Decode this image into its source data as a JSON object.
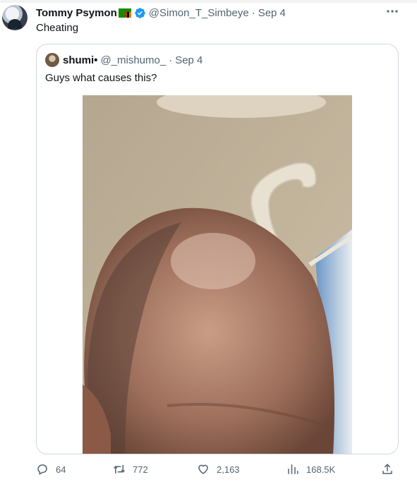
{
  "tweet": {
    "author_name": "Tommy Psymon",
    "author_handle": "@Simon_T_Simbeye",
    "date": "Sep 4",
    "separator": "·",
    "text": "Cheating"
  },
  "quoted": {
    "author_name": "shumi•",
    "author_handle": "@_mishumo_",
    "date": "Sep 4",
    "separator": "·",
    "text": "Guys what causes this?"
  },
  "actions": {
    "replies": "64",
    "retweets": "772",
    "likes": "2,163",
    "views": "168.5K"
  },
  "icons": {
    "more": "more-icon",
    "verified": "verified-badge-icon",
    "flag": "zambia-flag-icon",
    "reply": "reply-icon",
    "retweet": "retweet-icon",
    "like": "heart-icon",
    "views": "views-icon",
    "share": "share-icon"
  },
  "colors": {
    "verified": "#1d9bf0",
    "secondary_text": "#536471",
    "border": "#cfd9de"
  }
}
